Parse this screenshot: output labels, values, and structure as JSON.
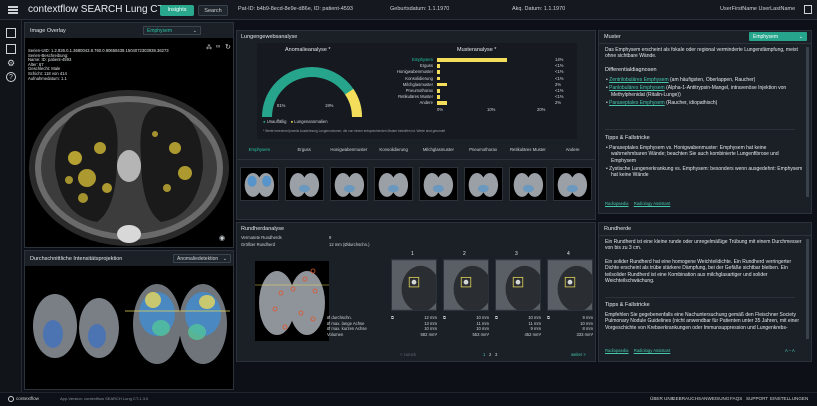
{
  "header": {
    "app_title": "contextflow SEARCH Lung CT",
    "tabs": [
      {
        "label": "Insights"
      },
      {
        "label": "Search"
      }
    ],
    "patient": "Pat-ID: b4b9-8ecd-8e9e-d86e, ID: patient-4593",
    "birth_date": "Geburtsdatum: 1.1.1970",
    "acq_date": "Akq. Datum: 1.1.1970",
    "user": "UserFirstName UserLastName"
  },
  "image_overlay": {
    "title": "Image Overlay",
    "select_value": "Emphysem",
    "metadata": [
      "Serien-UID: 1.2.826.0.1.3680043.8.760.0.90658439.1504072303938.36273",
      "Serien-Beschreibung:",
      "Name: ID: patient-4593",
      "Alter: 67",
      "Geschlecht: Male",
      "Schicht: 118 von 414",
      "Aufnahmedatum: 1.1"
    ]
  },
  "intensity_projection": {
    "title": "Durchschnittliche Intensitätsprojektion",
    "select_value": "Anomaliedetektion"
  },
  "lung_tissue": {
    "title": "Lungengewebsanalyse",
    "anomaly_title": "Anomalieanalyse *",
    "pattern_title": "Musteranalyse *",
    "gauge": {
      "normal_pct": "81%",
      "anomal_pct": "19%",
      "normal_fraction": 0.81
    },
    "legend_normal": "Unauffällig",
    "legend_anomal": "Lungenanomalien",
    "footnote": "* Werte berechnet jeweils Ausdehnung Lungenvolumen, die von einem entsprechenden Muster betroffen ist. Werte sind gerundet",
    "patterns": [
      {
        "label": "Emphysem",
        "value": 14,
        "text": "14%",
        "highlight": true
      },
      {
        "label": "Erguss",
        "value": 0.5,
        "text": "<1%"
      },
      {
        "label": "Honigwabenmuster",
        "value": 0.5,
        "text": "<1%"
      },
      {
        "label": "Konsolidierung",
        "value": 0.5,
        "text": "<1%"
      },
      {
        "label": "Milchglasmuster",
        "value": 2,
        "text": "2%"
      },
      {
        "label": "Pneumothorax",
        "value": 0.5,
        "text": "<1%"
      },
      {
        "label": "Retikuläres Muster",
        "value": 0.5,
        "text": "<1%"
      },
      {
        "label": "Andere",
        "value": 2,
        "text": "2%"
      }
    ],
    "x_ticks": [
      "0%",
      "10%",
      "20%"
    ],
    "categories": [
      "Emphysem",
      "Erguss",
      "Honigwabenmuster",
      "Konsolidierung",
      "Milchglasmuster",
      "Pneumothorax",
      "Retikuläres Muster",
      "Andere"
    ]
  },
  "nodules": {
    "title": "Rundherdanalyse",
    "suspected_label": "Vermutete Rundherds",
    "suspected_value": "9",
    "largest_label": "Größter Rundherd",
    "largest_value": "12 mm (Ødurchschn.)",
    "row_labels": [
      "Ø durchschn.",
      "Ø max. lange Achse",
      "Ø max. kurzen Achse",
      "Volumen"
    ],
    "items": [
      {
        "num": "1",
        "values": [
          "12 mm",
          "13 mm",
          "10 mm",
          "582 mm³"
        ]
      },
      {
        "num": "2",
        "values": [
          "10 mm",
          "11 mm",
          "10 mm",
          "553 mm³"
        ]
      },
      {
        "num": "3",
        "values": [
          "10 mm",
          "11 mm",
          "9 mm",
          "452 mm³"
        ]
      },
      {
        "num": "4",
        "values": [
          "9 mm",
          "10 mm",
          "8 mm",
          "333 mm³"
        ]
      }
    ],
    "prev": "< zurück",
    "pages": [
      "1",
      "2",
      "3"
    ],
    "next": "weiter >"
  },
  "muster": {
    "title": "Muster",
    "select_value": "Emphysem",
    "intro": "Das Emphysem erscheint als fokale oder regional verminderte Lungendämpfung, meist ohne sichtbare Wände.",
    "diff_title": "Differentialdiagnosen",
    "diff_items": [
      {
        "link": "Zentrilobuläres Emphysem",
        "rest": " (am häufigsten, Oberlappen, Raucher)"
      },
      {
        "link": "Panlobuläres Emphysem",
        "rest": " (Alpha-1-Antitrypsin-Mangel, intravenöse Injektion von Methylphenidat (Ritalin-Lunge))"
      },
      {
        "link": "Paraseptales Emphysem",
        "rest": " (Raucher, idiopathisch)"
      }
    ],
    "tips_title": "Tipps & Fallstricke",
    "tips": [
      "Paraseptales Emphysem vs. Honigwabenmuster: Emphysem hat keine wahrnehmbaren Wände; beachten Sie auch kombinierte Lungenfibrose und Emphysem",
      "Zystische Lungenerkrankung vs. Emphysem: besonders wenn ausgedehnt: Emphysem hat keine Wände"
    ],
    "links": [
      "Radiopaedia",
      "Radiology Assistant"
    ]
  },
  "rundherde": {
    "title": "Rundherde",
    "p1": "Ein Rundherd ist eine kleine runde oder unregelmäßige Trübung mit einem Durchmesser von bis zu 3 cm.",
    "p2": "Ein solider Rundherd hat eine homogene Weichteildichte. Ein Rundherd verringerter Dichte erscheint als trübe stärkere Dämpfung, bei der Gefäße sichtbar bleiben. Ein teilsolider Rundherd ist eine Kombination aus milchglasartiger und solider Weichteilschwächung.",
    "tips_title": "Tipps & Fallstricke",
    "p3": "Empfehlen Sie gegebenenfalls eine Nachuntersuchung gemäß den Fleischner Society Pulmonary Nodule Guidelines (nicht anwendbar für Patienten unter 35 Jahren, mit einer Vorgeschichte von Krebserkrankungen oder Immunsuppression und Lungenkrebs-",
    "links": [
      "Radiopaedia",
      "Radiology Assistant"
    ],
    "font_toggle": "A – A"
  },
  "footer": {
    "brand": "contextflow",
    "version": "App-Version: contextflow SEARCH Lung CT-1.3.0",
    "links": [
      "ÜBER UNS",
      "GEBRAUCHSANWEISUNG",
      "FAQS",
      "SUPPORT",
      "EINSTELLUNGEN"
    ]
  },
  "colors": {
    "accent": "#27a58c",
    "yellow": "#f3dd5a",
    "panel": "#1b2027"
  }
}
